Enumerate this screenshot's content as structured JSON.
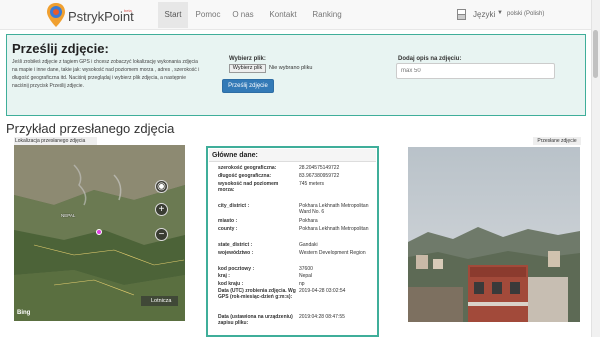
{
  "brand": {
    "name": "PstrykPoint",
    "badge": "beta"
  },
  "nav": {
    "items": [
      {
        "label": "Start",
        "active": true
      },
      {
        "label": "Pomoc",
        "active": false
      },
      {
        "label": "O nas",
        "active": false
      },
      {
        "label": "Kontakt",
        "active": false
      },
      {
        "label": "Ranking",
        "active": false
      }
    ],
    "language_label": "Języki",
    "language_current": "polski (Polish)"
  },
  "upload": {
    "title": "Prześlij zdjęcie:",
    "description": "Jeśli zrobiłeś zdjęcie z tagiem GPS i chcesz zobaczyć lokalizację wykonania zdjęcia na mapie i inne dane, takie jak: wysokość nad poziomem morza , adres , szerokość i długość geograficzna itd. Naciśnij przeglądaj i wybierz plik zdjęcia, a następnie naciśnij przycisk Prześlij zdjęcie.",
    "file_label": "Wybierz plik:",
    "file_button": "Wybierz plik",
    "file_none": "Nie wybrano pliku",
    "submit": "Prześlij zdjęcie",
    "desc_label": "Dodaj opis na zdjęciu:",
    "desc_placeholder": "max 50"
  },
  "example": {
    "title": "Przykład przesłanego zdjęcia",
    "map_label": "Lokalizacja przesłanego zdjęcia",
    "map_layer_label": "Lotnicza",
    "map_place": "NEPAL",
    "map_provider": "Bing",
    "photo_label": "Przesłane zdjęcie",
    "info_title": "Główne dane:",
    "rows": [
      {
        "key": "szerokość geograficzna:",
        "value": "28.204575149722"
      },
      {
        "key": "długość geograficzna:",
        "value": "83.967380959722"
      },
      {
        "key": "wysokość nad poziomem morza:",
        "value": "745 meters"
      },
      {
        "key": "city_district :",
        "value": "Pokhara Lekhnath Metropolitan Ward No. 6"
      },
      {
        "key": "miasto :",
        "value": "Pokhara"
      },
      {
        "key": "county :",
        "value": "Pokhara Lekhnath Metropolitan"
      },
      {
        "key": "state_district :",
        "value": "Gandaki"
      },
      {
        "key": "województwo :",
        "value": "Western Development Region"
      },
      {
        "key": "kod pocztowy :",
        "value": "37600"
      },
      {
        "key": "kraj :",
        "value": "Nepal"
      },
      {
        "key": "kod kraju :",
        "value": "np"
      },
      {
        "key": "Data (UTC) zrobienia zdjęcia. Wg GPS (rok-miesiąc-dzień g:m:s):",
        "value": "2019-04-28 03:02:54"
      },
      {
        "key": "Data (ustawiona na urządzeniu) zapisu pliku:",
        "value": "2019:04:28 08:47:55"
      }
    ]
  }
}
